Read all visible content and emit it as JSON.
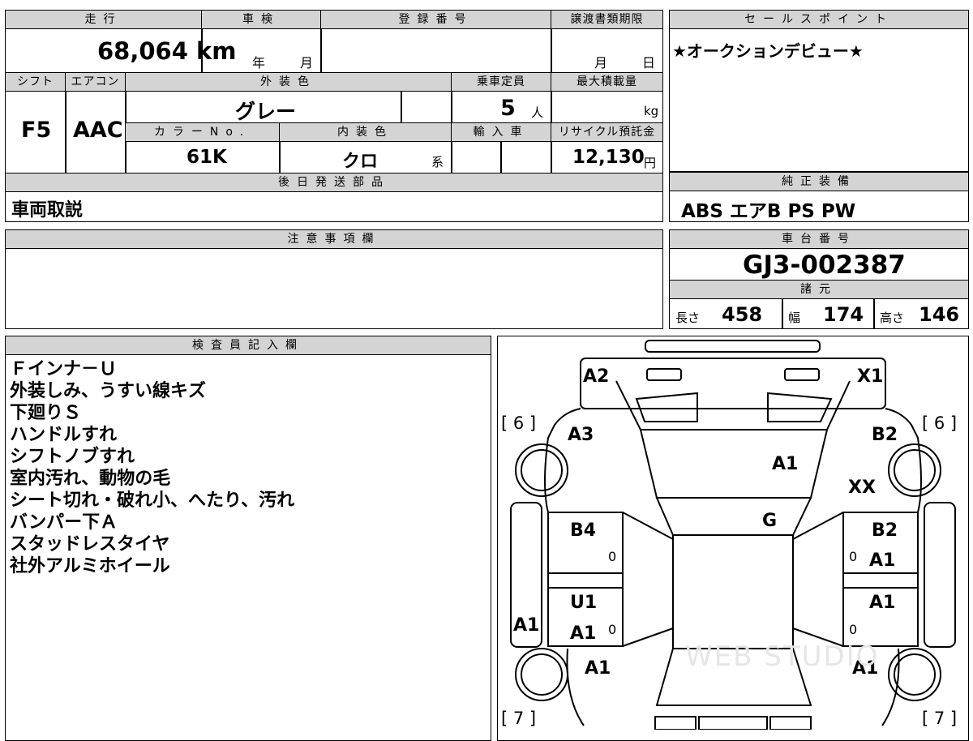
{
  "sheet": {
    "mileage_header": "走行",
    "mileage": "68,064 km",
    "inspection_header": "車検",
    "inspection_year_unit": "年",
    "inspection_month_unit": "月",
    "registration_header": "登録番号",
    "transfer_deadline_header": "譲渡書類期限",
    "transfer_month_unit": "月",
    "transfer_day_unit": "日",
    "shift_header": "シフト",
    "shift": "F5",
    "aircon_header": "エアコン",
    "aircon": "AAC",
    "exterior_color_header": "外装色",
    "exterior_color": "グレー",
    "capacity_header": "乗車定員",
    "capacity": "5",
    "capacity_unit": "人",
    "max_load_header": "最大積載量",
    "max_load_unit": "kg",
    "color_no_header": "カラーNo.",
    "color_no": "61K",
    "interior_color_header": "内装色",
    "interior_color": "クロ",
    "interior_color_unit": "系",
    "import_header": "輸入車",
    "recycle_header": "リサイクル預託金",
    "recycle_fee": "12,130",
    "recycle_unit": "円",
    "later_parts_header": "後日発送部品",
    "later_parts": "車両取説",
    "sales_point_header": "セールスポイント",
    "sales_point": "★オークションデビュー★",
    "equipment_header": "純正装備",
    "equipment": "ABS エアB PS PW",
    "caution_header": "注意事項欄",
    "chassis_header": "車台番号",
    "chassis_no": "GJ3-002387",
    "spec_header": "諸元",
    "length_label": "長さ",
    "length": "458",
    "width_label": "幅",
    "width": "174",
    "height_label": "高さ",
    "height": "146",
    "inspector_header": "検査員記入欄",
    "inspector_notes": [
      "Ｆインナ－Ｕ",
      "外装しみ、うすい線キズ",
      "下廻りＳ",
      "ハンドルすれ",
      "シフトノブすれ",
      "室内汚れ、動物の毛",
      "シート切れ・破れ小、へたり、汚れ",
      "バンパー下Ａ",
      "スタッドレスタイヤ",
      "社外アルミホイール"
    ]
  },
  "diagram": {
    "tire_fl": "[ 6 ]",
    "tire_fr": "[ 6 ]",
    "tire_rl": "[ 7 ]",
    "tire_rr": "[ 7 ]",
    "front_left": "A2",
    "front_right": "X1",
    "fender_left": "A3",
    "fender_right": "B2",
    "hood": "A1",
    "fender_right_extra": "XX",
    "windshield": "G",
    "door_fl": "B4",
    "door_fr": "B2",
    "door_fr_extra": "A1",
    "door_rl_1": "U1",
    "door_rl_2": "A1",
    "door_rr": "A1",
    "sill_left": "A1",
    "rear_fender_left": "A1",
    "rear_fender_right": "A1",
    "zero": "0",
    "watermark": "WEB STUDIO"
  }
}
